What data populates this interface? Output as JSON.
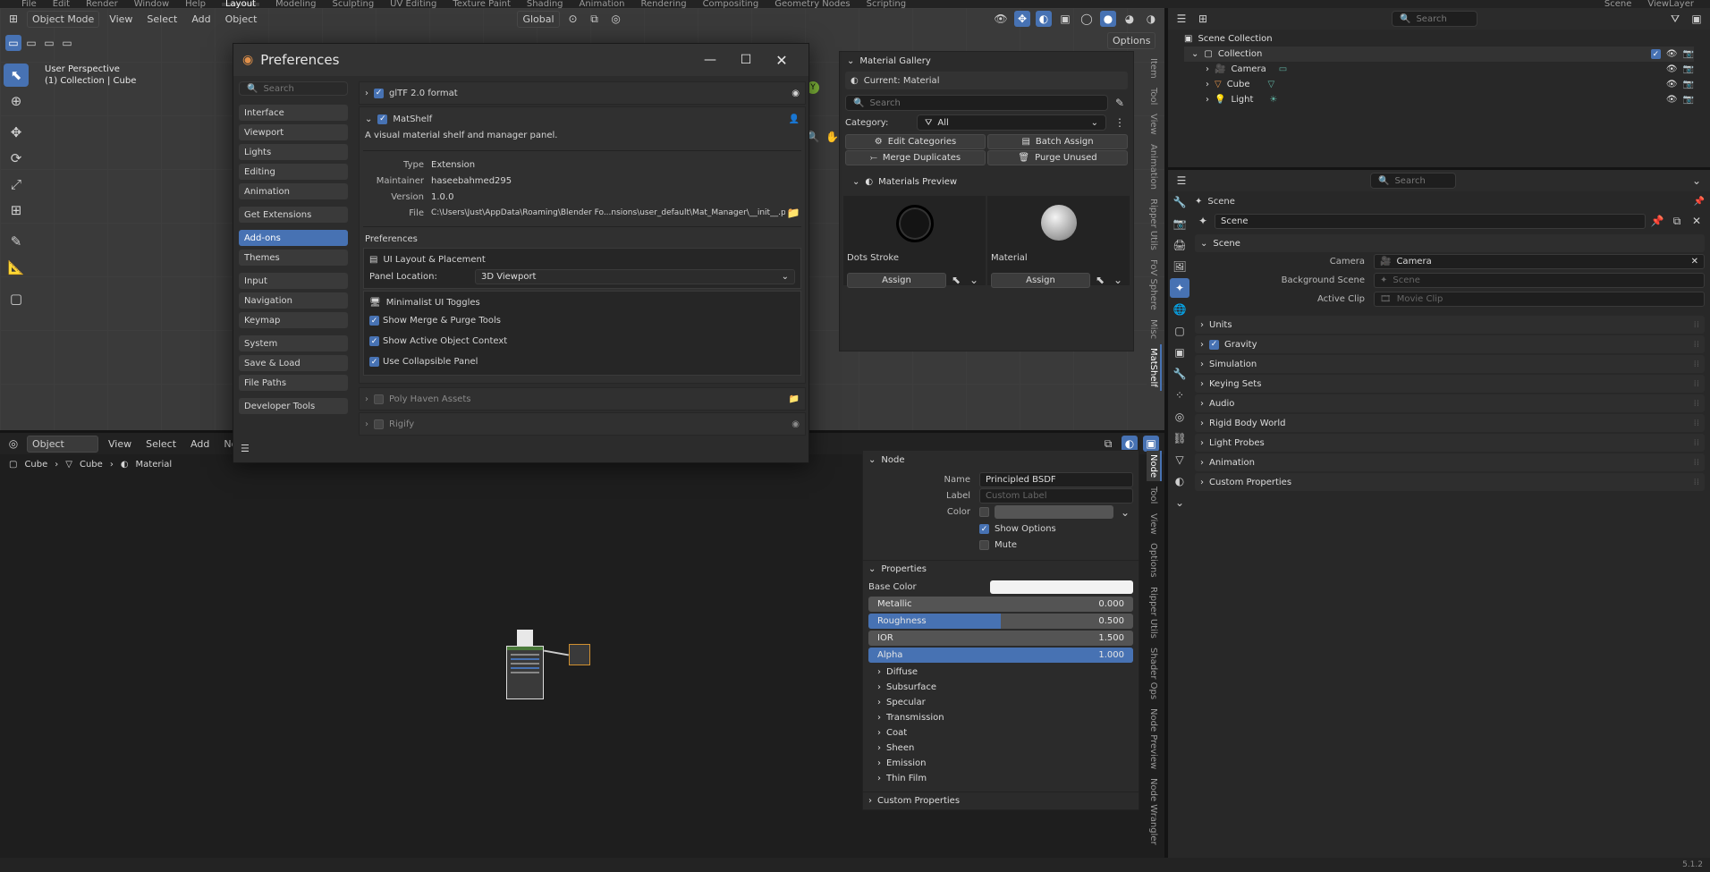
{
  "topbar": {
    "items": [
      "File",
      "Edit",
      "Render",
      "Window",
      "Help",
      "Layout",
      "Modeling",
      "Sculpting",
      "UV Editing",
      "Texture Paint",
      "Shading",
      "Animation",
      "Rendering",
      "Compositing",
      "Geometry Nodes",
      "Scripting"
    ],
    "active": "Layout",
    "scene": "Scene",
    "view_layer": "ViewLayer"
  },
  "viewport": {
    "mode": "Object Mode",
    "menus": [
      "View",
      "Select",
      "Add",
      "Object"
    ],
    "orientation": "Global",
    "options_label": "Options",
    "info_line1": "User Perspective",
    "info_line2": "(1) Collection | Cube",
    "side_tabs": [
      "Item",
      "Tool",
      "View",
      "Animation",
      "Ripper Utils",
      "FoV Sphere",
      "Misc",
      "MatShelf"
    ],
    "active_tab": "MatShelf"
  },
  "material_gallery": {
    "title": "Material Gallery",
    "current": "Current: Material",
    "search_placeholder": "Search",
    "category_label": "Category:",
    "category_value": "All",
    "buttons": {
      "edit_categories": "Edit Categories",
      "batch_assign": "Batch Assign",
      "merge_duplicates": "Merge Duplicates",
      "purge_unused": "Purge Unused"
    },
    "preview_title": "Materials Preview",
    "items": [
      {
        "name": "Dots Stroke",
        "assign": "Assign"
      },
      {
        "name": "Material",
        "assign": "Assign"
      }
    ]
  },
  "preferences": {
    "title": "Preferences",
    "search_placeholder": "Search",
    "nav_groups": [
      [
        "Interface",
        "Viewport",
        "Lights",
        "Editing",
        "Animation"
      ],
      [
        "Get Extensions"
      ],
      [
        "Add-ons",
        "Themes"
      ],
      [
        "Input",
        "Navigation",
        "Keymap"
      ],
      [
        "System",
        "Save & Load",
        "File Paths"
      ],
      [
        "Developer Tools"
      ]
    ],
    "active_nav": "Add-ons",
    "addons": {
      "gltf": "glTF 2.0 format",
      "matshelf": {
        "name": "MatShelf",
        "desc": "A visual material shelf and manager panel.",
        "type_label": "Type",
        "type": "Extension",
        "maintainer_label": "Maintainer",
        "maintainer": "haseebahmed295",
        "version_label": "Version",
        "version": "1.0.0",
        "file_label": "File",
        "file": "C:\\Users\\Just\\AppData\\Roaming\\Blender Fo...nsions\\user_default\\Mat_Manager\\__init__.py"
      },
      "prefs_title": "Preferences",
      "ui_layout_title": "UI Layout & Placement",
      "panel_location_label": "Panel Location:",
      "panel_location_value": "3D Viewport",
      "minimalist_title": "Minimalist UI Toggles",
      "toggles": [
        "Show Merge & Purge Tools",
        "Show Active Object Context",
        "Use Collapsible Panel"
      ],
      "poly_haven": "Poly Haven Assets",
      "rigify": "Rigify"
    }
  },
  "node_editor": {
    "mode": "Object",
    "menus": [
      "View",
      "Select",
      "Add",
      "Node"
    ],
    "breadcrumb": [
      "Cube",
      "Cube",
      "Material"
    ],
    "side_tabs": [
      "Node",
      "Tool",
      "View",
      "Options",
      "Ripper Utils",
      "Shader Ops",
      "Node Preview",
      "Node Wrangler"
    ],
    "active_tab": "Node",
    "node": {
      "section": "Node",
      "name_label": "Name",
      "name": "Principled BSDF",
      "label_label": "Label",
      "label_placeholder": "Custom Label",
      "color_label": "Color",
      "show_options": "Show Options",
      "mute": "Mute"
    },
    "properties": {
      "section": "Properties",
      "base_color_label": "Base Color",
      "sliders": [
        {
          "label": "Metallic",
          "value": "0.000",
          "fill": 0
        },
        {
          "label": "Roughness",
          "value": "0.500",
          "fill": 0.5
        },
        {
          "label": "IOR",
          "value": "1.500",
          "fill": 0
        },
        {
          "label": "Alpha",
          "value": "1.000",
          "fill": 1
        }
      ],
      "subsections": [
        "Diffuse",
        "Subsurface",
        "Specular",
        "Transmission",
        "Coat",
        "Sheen",
        "Emission",
        "Thin Film"
      ]
    },
    "custom_props": "Custom Properties"
  },
  "outliner": {
    "search_placeholder": "Search",
    "root": "Scene Collection",
    "collection": "Collection",
    "items": [
      "Camera",
      "Cube",
      "Light"
    ]
  },
  "properties_editor": {
    "search_placeholder": "Search",
    "context": "Scene",
    "datablock": "Scene",
    "section": "Scene",
    "camera_label": "Camera",
    "camera_value": "Camera",
    "bg_scene_label": "Background Scene",
    "bg_scene_value": "Scene",
    "active_clip_label": "Active Clip",
    "active_clip_value": "Movie Clip",
    "sections": [
      "Units",
      "Gravity",
      "Simulation",
      "Keying Sets",
      "Audio",
      "Rigid Body World",
      "Light Probes",
      "Animation",
      "Custom Properties"
    ]
  },
  "status": {
    "version": "5.1.2"
  },
  "colors": {
    "accent": "#4772b3",
    "bg": "#1d1d1d",
    "panel": "#2b2b2b"
  }
}
